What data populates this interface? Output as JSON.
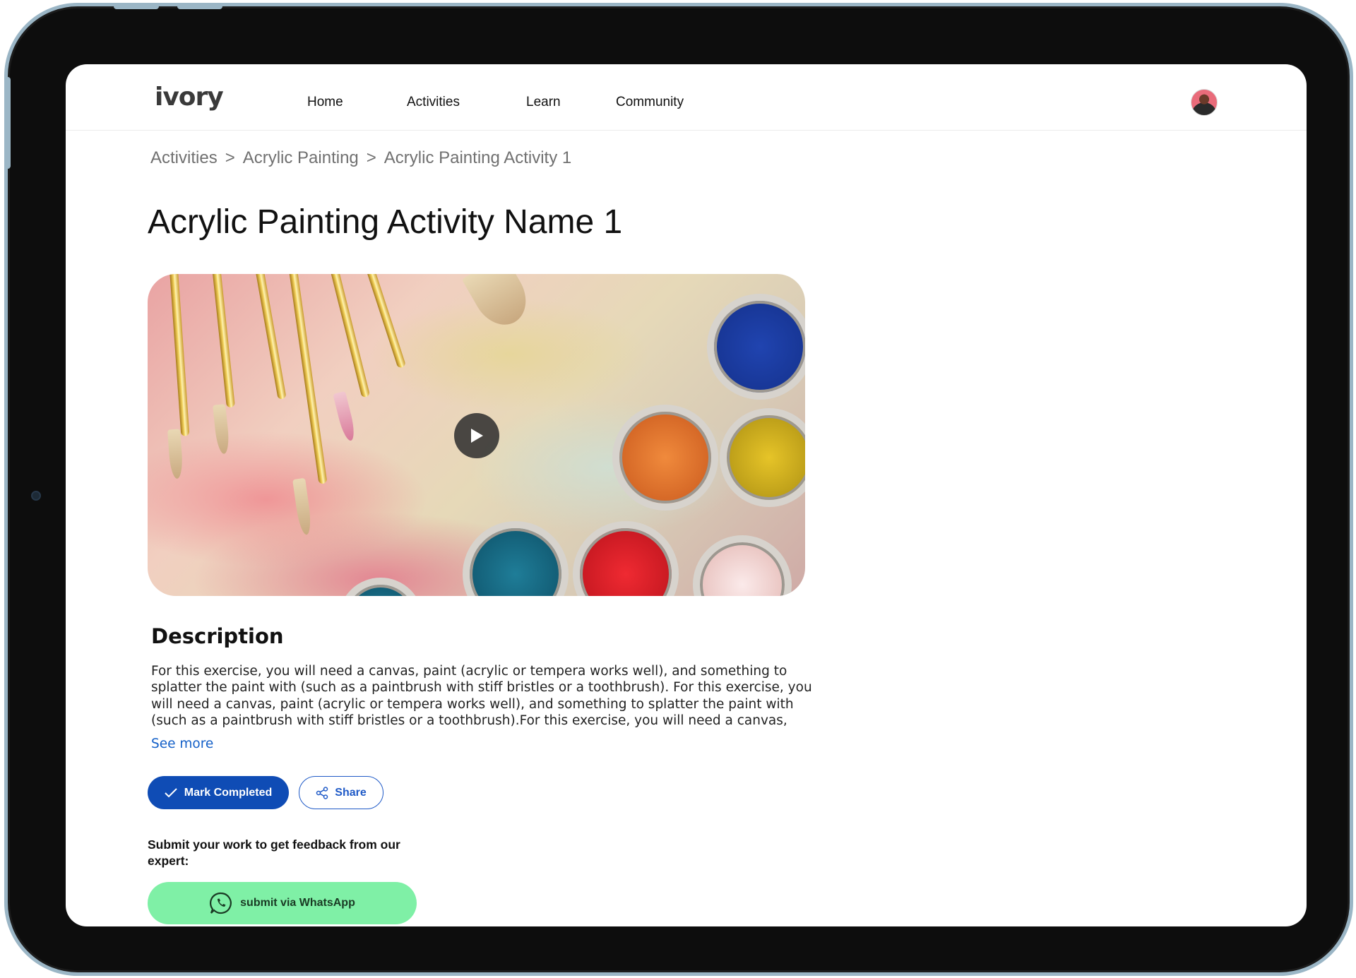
{
  "app": {
    "logo_text": "ivory",
    "accent_color": "#0f4cb5"
  },
  "nav": {
    "items": [
      {
        "label": "Home"
      },
      {
        "label": "Activities"
      },
      {
        "label": "Learn"
      },
      {
        "label": "Community"
      }
    ],
    "avatar_icon": "user-avatar"
  },
  "breadcrumb": {
    "items": [
      "Activities",
      "Acrylic Painting",
      "Acrylic Painting Activity 1"
    ],
    "separator": ">"
  },
  "page": {
    "title": "Acrylic Painting Activity Name 1"
  },
  "media": {
    "play_icon": "play-icon"
  },
  "description": {
    "heading": "Description",
    "text": "For this exercise, you will need a canvas, paint (acrylic or tempera works well), and something to splatter the paint with (such as a paintbrush with stiff bristles or a toothbrush). For this exercise, you will need a canvas, paint (acrylic or tempera works well), and something to splatter the paint with (such as a paintbrush with stiff bristles or a toothbrush).For this exercise, you will need a canvas,",
    "see_more": "See more"
  },
  "actions": {
    "mark_completed": "Mark Completed",
    "share": "Share"
  },
  "submission": {
    "prompt": "Submit your work to get feedback from our expert:",
    "whatsapp_label": "submit via WhatsApp",
    "whatsapp_color": "#7ff0a6"
  }
}
